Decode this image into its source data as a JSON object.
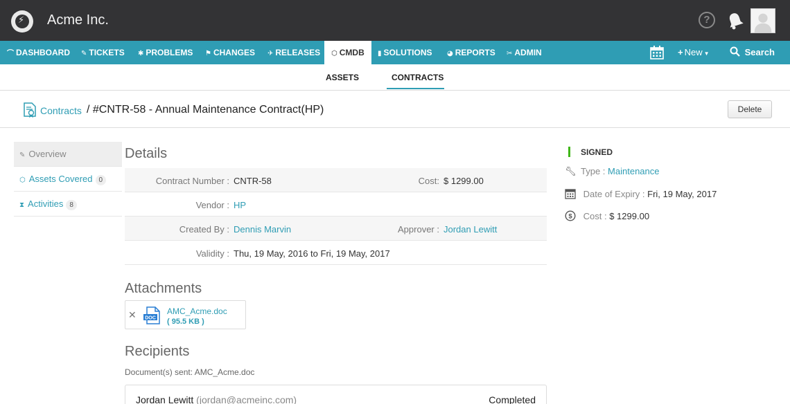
{
  "app": {
    "org_name": "Acme Inc.",
    "help_glyph": "?"
  },
  "nav": {
    "items": [
      {
        "icon": "⌒",
        "label": "DASHBOARD"
      },
      {
        "icon": "✎",
        "label": "TICKETS"
      },
      {
        "icon": "✱",
        "label": "PROBLEMS"
      },
      {
        "icon": "⚑",
        "label": "CHANGES"
      },
      {
        "icon": "✈",
        "label": "RELEASES"
      },
      {
        "icon": "⬡",
        "label": "CMDB"
      },
      {
        "icon": "▮",
        "label": "SOLUTIONS"
      },
      {
        "icon": "◕",
        "label": "REPORTS"
      },
      {
        "icon": "✂",
        "label": "ADMIN"
      }
    ],
    "active": "CMDB",
    "new_label": "New",
    "search_label": "Search"
  },
  "subnav": {
    "tabs": [
      "ASSETS",
      "CONTRACTS"
    ],
    "active": "CONTRACTS"
  },
  "header": {
    "breadcrumb_link": "Contracts",
    "title": "/ #CNTR-58  - Annual Maintenance Contract(HP)",
    "delete_label": "Delete"
  },
  "sidebar": {
    "items": [
      {
        "icon": "✎",
        "label": "Overview",
        "count": ""
      },
      {
        "icon": "⬡",
        "label": "Assets Covered",
        "count": "0"
      },
      {
        "icon": "⧗",
        "label": "Activities",
        "count": "8"
      }
    ]
  },
  "details": {
    "heading": "Details",
    "contract_number_label": "Contract Number :",
    "contract_number": "CNTR-58",
    "cost_label": "Cost:",
    "cost": "$ 1299.00",
    "vendor_label": "Vendor :",
    "vendor": "HP",
    "created_by_label": "Created By :",
    "created_by": "Dennis Marvin",
    "approver_label": "Approver :",
    "approver": "Jordan Lewitt",
    "validity_label": "Validity :",
    "validity": "Thu, 19 May, 2016 to Fri, 19 May, 2017"
  },
  "attachments": {
    "heading": "Attachments",
    "remove_glyph": "✕",
    "file_name": "AMC_Acme.doc",
    "file_size": "( 95.5 KB )",
    "doc_badge": "DOC"
  },
  "recipients": {
    "heading": "Recipients",
    "documents_sent": "Document(s) sent: AMC_Acme.doc",
    "name": "Jordan Lewitt",
    "email": "(jordan@acmeinc.com)",
    "status": "Completed"
  },
  "summary": {
    "status": "SIGNED",
    "type_label": "Type :",
    "type": "Maintenance",
    "expiry_label": "Date of Expiry :",
    "expiry": "Fri, 19 May, 2017",
    "cost_label": "Cost :",
    "cost": "$ 1299.00"
  },
  "colors": {
    "topbar": "#333335",
    "nav": "#2f9db4",
    "link": "#2f9db4",
    "signed": "#3fb618"
  }
}
